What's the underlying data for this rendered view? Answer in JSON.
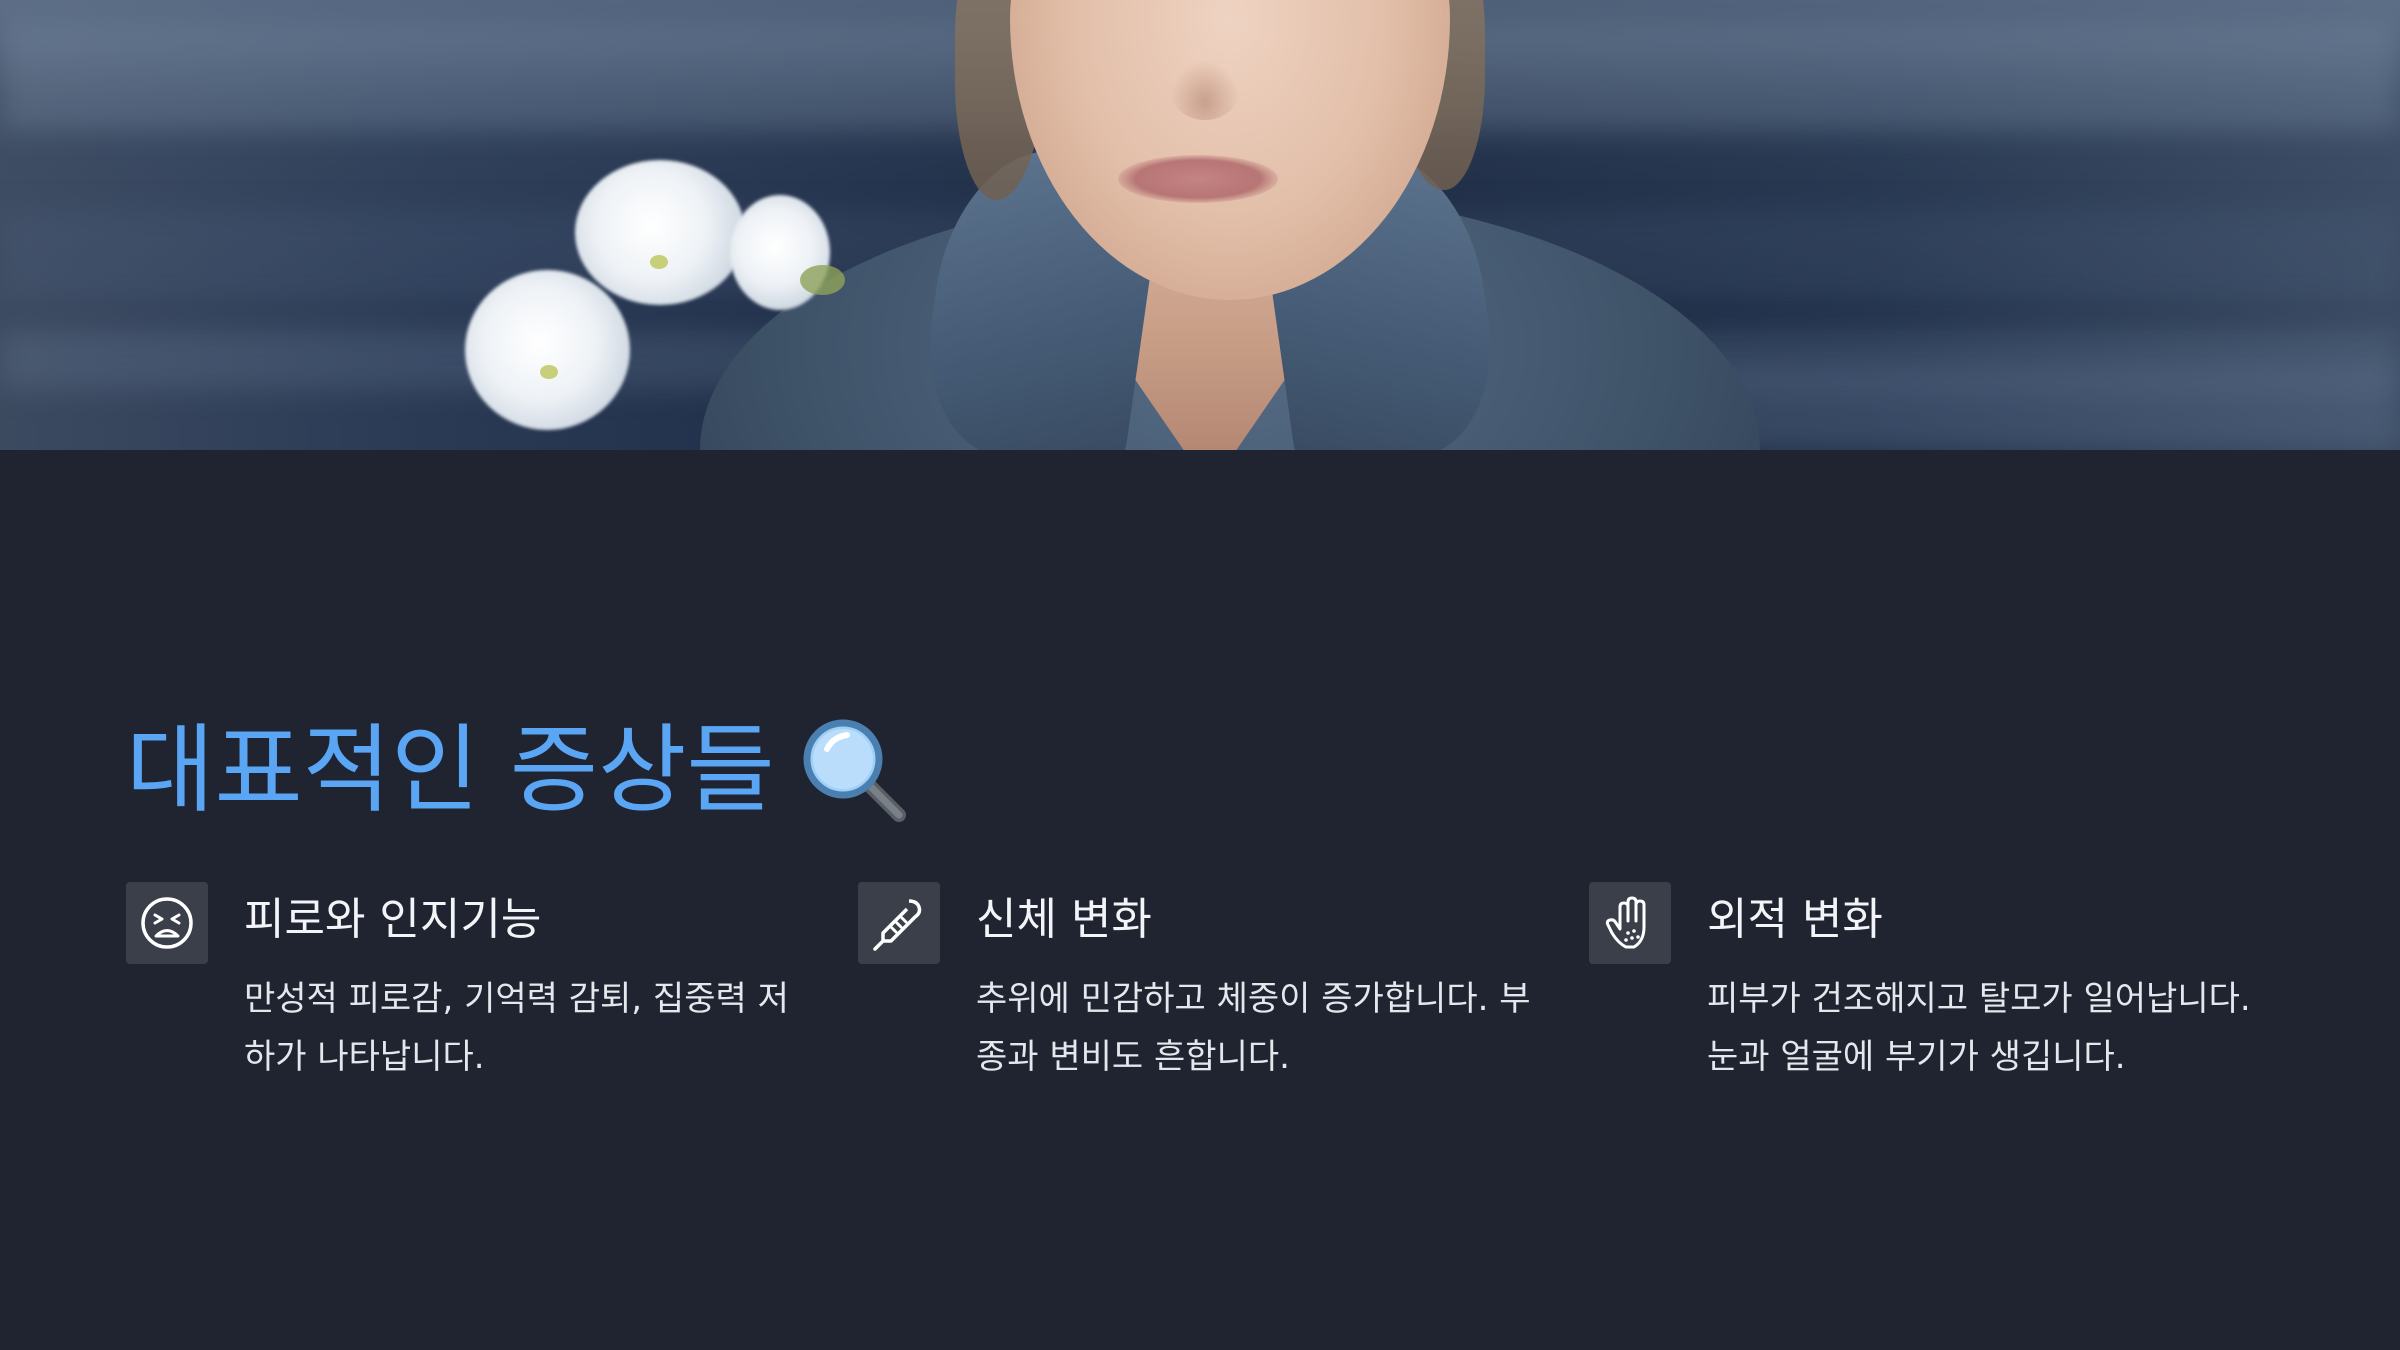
{
  "heading": {
    "title": "대표적인 증상들",
    "emoji_icon": "magnifying-glass-icon"
  },
  "symptoms": [
    {
      "icon": "tired-face-icon",
      "title": "피로와 인지기능",
      "description": "만성적 피로감, 기억력 감퇴, 집중력 저하가 나타납니다."
    },
    {
      "icon": "thermometer-icon",
      "title": "신체 변화",
      "description": "추위에 민감하고 체중이 증가합니다. 부종과 변비도 흔합니다."
    },
    {
      "icon": "hand-icon",
      "title": "외적 변화",
      "description": "피부가 건조해지고 탈모가 일어납니다. 눈과 얼굴에 부기가 생깁니다."
    }
  ],
  "colors": {
    "background": "#1f2430",
    "title_accent": "#5aa6f5",
    "icon_box": "#3a3f4a",
    "text": "#f2f4f7"
  }
}
